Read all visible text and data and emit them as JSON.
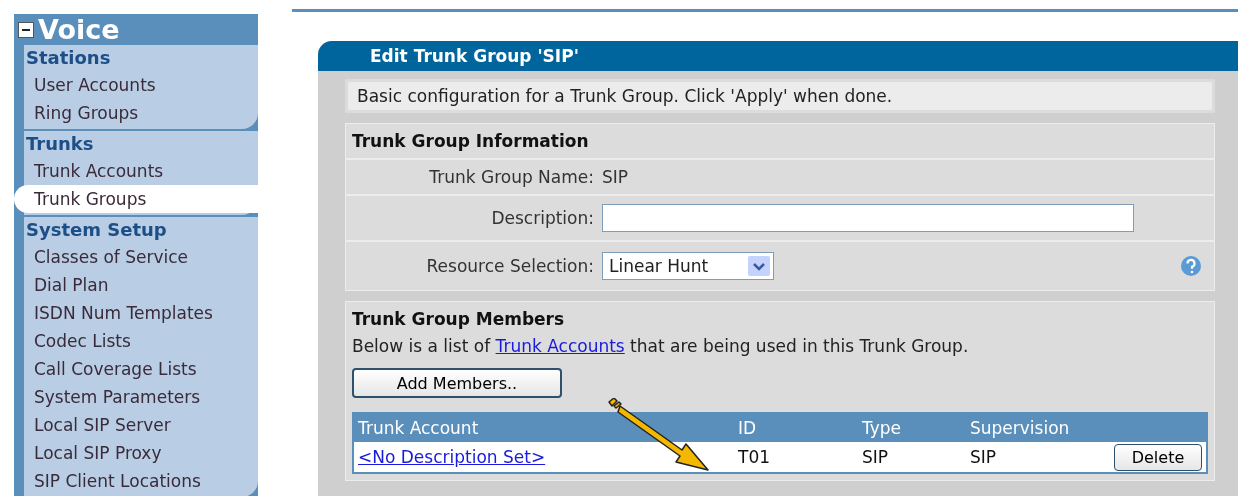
{
  "sidebar": {
    "title": "Voice",
    "expanded": true,
    "sections": [
      {
        "heading": "Stations",
        "items": [
          {
            "label": "User Accounts",
            "selected": false
          },
          {
            "label": "Ring Groups",
            "selected": false
          }
        ]
      },
      {
        "heading": "Trunks",
        "items": [
          {
            "label": "Trunk Accounts",
            "selected": false
          },
          {
            "label": "Trunk Groups",
            "selected": true
          }
        ]
      },
      {
        "heading": "System Setup",
        "items": [
          {
            "label": "Classes of Service",
            "selected": false
          },
          {
            "label": "Dial Plan",
            "selected": false
          },
          {
            "label": "ISDN Num Templates",
            "selected": false
          },
          {
            "label": "Codec Lists",
            "selected": false
          },
          {
            "label": "Call Coverage Lists",
            "selected": false
          },
          {
            "label": "System Parameters",
            "selected": false
          },
          {
            "label": "Local SIP Server",
            "selected": false
          },
          {
            "label": "Local SIP Proxy",
            "selected": false
          },
          {
            "label": "SIP Client Locations",
            "selected": false
          }
        ]
      }
    ]
  },
  "panel": {
    "title": "Edit Trunk Group 'SIP'",
    "intro": "Basic configuration for a Trunk Group. Click 'Apply' when done.",
    "info": {
      "heading": "Trunk Group Information",
      "name_label": "Trunk Group Name:",
      "name_value": "SIP",
      "description_label": "Description:",
      "resource_label": "Resource Selection:",
      "resource_value": "Linear Hunt"
    },
    "members": {
      "heading": "Trunk Group Members",
      "text_before": "Below is a list of ",
      "link": "Trunk Accounts",
      "text_after": " that are being used in this Trunk Group.",
      "add_button": "Add Members..",
      "columns": [
        "Trunk Account",
        "ID",
        "Type",
        "Supervision"
      ],
      "rows": [
        {
          "account": "<No Description Set>",
          "id": "T01",
          "type": "SIP",
          "supervision": "SIP",
          "action": "Delete"
        }
      ]
    }
  }
}
